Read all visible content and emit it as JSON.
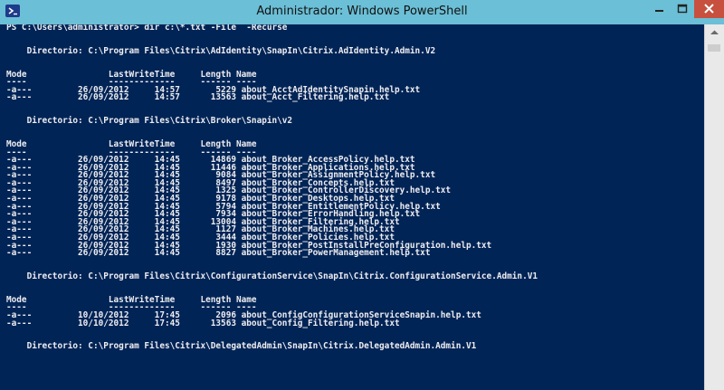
{
  "window": {
    "title": "Administrador: Windows PowerShell",
    "icon": "powershell-icon",
    "controls": [
      "minimize-icon",
      "maximize-icon",
      "close-icon"
    ]
  },
  "colors": {
    "console_bg": "#012456",
    "console_text": "#eeedf0",
    "titlebar": "#6bbfd6",
    "close_button": "#c7503f"
  },
  "console": {
    "lines": [
      "PS C:\\Users\\administrator> dir c:\\*.txt -File  -Recurse",
      "",
      "",
      "    Directorio: C:\\Program Files\\Citrix\\AdIdentity\\SnapIn\\Citrix.AdIdentity.Admin.V2",
      "",
      "",
      "Mode                LastWriteTime     Length Name",
      "----                -------------     ------ ----",
      "-a---         26/09/2012     14:57       5229 about_AcctAdIdentitySnapin.help.txt",
      "-a---         26/09/2012     14:57      13563 about_Acct_Filtering.help.txt",
      "",
      "",
      "    Directorio: C:\\Program Files\\Citrix\\Broker\\Snapin\\v2",
      "",
      "",
      "Mode                LastWriteTime     Length Name",
      "----                -------------     ------ ----",
      "-a---         26/09/2012     14:45      14869 about_Broker_AccessPolicy.help.txt",
      "-a---         26/09/2012     14:45      11446 about_Broker_Applications.help.txt",
      "-a---         26/09/2012     14:45       9084 about_Broker_AssignmentPolicy.help.txt",
      "-a---         26/09/2012     14:45       8497 about_Broker_Concepts.help.txt",
      "-a---         26/09/2012     14:45       1325 about_Broker_ControllerDiscovery.help.txt",
      "-a---         26/09/2012     14:45       9178 about_Broker_Desktops.help.txt",
      "-a---         26/09/2012     14:45       5794 about_Broker_EntitlementPolicy.help.txt",
      "-a---         26/09/2012     14:45       7934 about_Broker_ErrorHandling.help.txt",
      "-a---         26/09/2012     14:45      13004 about_Broker_Filtering.help.txt",
      "-a---         26/09/2012     14:45       1127 about_Broker_Machines.help.txt",
      "-a---         26/09/2012     14:45       3444 about_Broker_Policies.help.txt",
      "-a---         26/09/2012     14:45       1930 about_Broker_PostInstallPreConfiguration.help.txt",
      "-a---         26/09/2012     14:45       8827 about_Broker_PowerManagement.help.txt",
      "",
      "",
      "    Directorio: C:\\Program Files\\Citrix\\ConfigurationService\\SnapIn\\Citrix.ConfigurationService.Admin.V1",
      "",
      "",
      "Mode                LastWriteTime     Length Name",
      "----                -------------     ------ ----",
      "-a---         10/10/2012     17:45       2096 about_ConfigConfigurationServiceSnapin.help.txt",
      "-a---         10/10/2012     17:45      13563 about_Config_Filtering.help.txt",
      "",
      "",
      "    Directorio: C:\\Program Files\\Citrix\\DelegatedAdmin\\SnapIn\\Citrix.DelegatedAdmin.Admin.V1"
    ]
  }
}
